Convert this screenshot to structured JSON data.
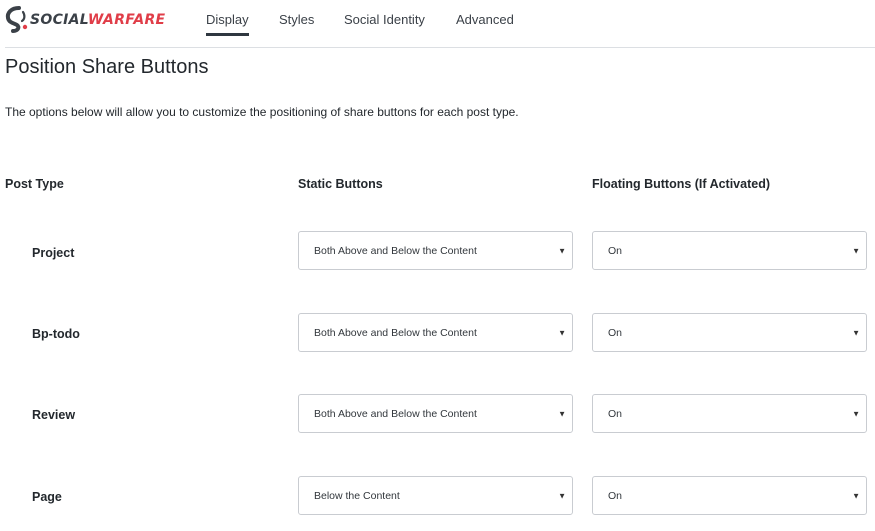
{
  "brand": {
    "part1": "SOCIAL",
    "part2": "WARFARE"
  },
  "nav": {
    "tabs": [
      "Display",
      "Styles",
      "Social Identity",
      "Advanced"
    ],
    "active": "Display"
  },
  "page": {
    "title": "Position Share Buttons",
    "description": "The options below will allow you to customize the positioning of share buttons for each post type."
  },
  "table": {
    "headers": [
      "Post Type",
      "Static Buttons",
      "Floating Buttons (If Activated)"
    ],
    "rows": [
      {
        "post_type": "Project",
        "static": "Both Above and Below the Content",
        "floating": "On"
      },
      {
        "post_type": "Bp-todo",
        "static": "Both Above and Below the Content",
        "floating": "On"
      },
      {
        "post_type": "Review",
        "static": "Both Above and Below the Content",
        "floating": "On"
      },
      {
        "post_type": "Page",
        "static": "Below the Content",
        "floating": "On"
      }
    ]
  },
  "icons": {
    "logo": "social-warfare-logo-icon",
    "dropdown": "chevron-down-icon"
  },
  "colors": {
    "brand_red": "#e03d48",
    "brand_dark": "#3b4148",
    "active_underline": "#2f3740"
  }
}
